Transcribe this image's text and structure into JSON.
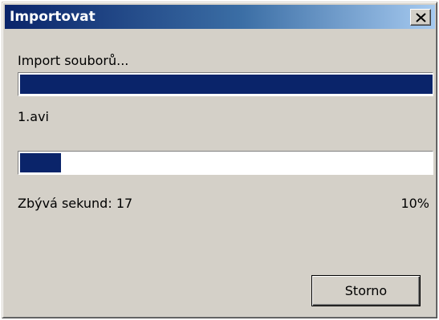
{
  "window": {
    "title": "Importovat",
    "close_symbol": "×"
  },
  "overall": {
    "label": "Import souborů...",
    "progress_fraction": 1.0
  },
  "file": {
    "name": "1.avi",
    "progress_fraction": 0.1,
    "remaining_text": "Zbývá sekund: 17",
    "percent_text": "10%"
  },
  "buttons": {
    "cancel_label": "Storno"
  },
  "colors": {
    "title_gradient_start": "#0a246a",
    "title_gradient_end": "#a6caf0",
    "progress_fill": "#0a246a",
    "window_face": "#d4d0c8"
  },
  "icons": {
    "close": "close-icon"
  }
}
